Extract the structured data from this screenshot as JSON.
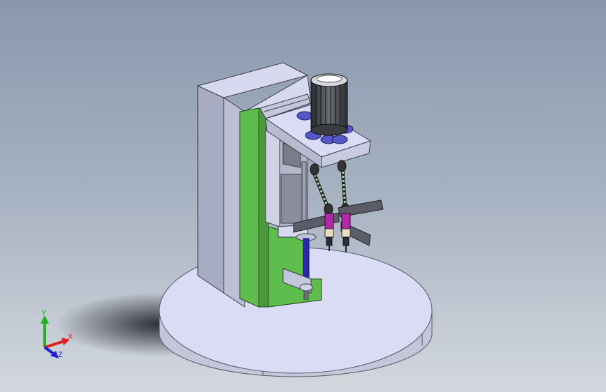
{
  "viewport": {
    "background_top": "#8a98ad",
    "background_bottom": "#d3d8de"
  },
  "model": {
    "colors": {
      "base_top": "#d9dcf4",
      "base_side": "#c0c3d8",
      "column": "#d6d9ef",
      "column_side": "#a9adc4",
      "green_plate": "#5ebd4c",
      "spindle_motor": "#3b3d42",
      "bolt": "#5656c8",
      "magenta_part": "#b02aa7",
      "spring": "#a6d7a0"
    }
  },
  "triad": {
    "x_label": "X",
    "y_label": "Y",
    "z_label": "Z",
    "x_color": "#e02020",
    "y_color": "#20b020",
    "z_color": "#2020d0"
  }
}
